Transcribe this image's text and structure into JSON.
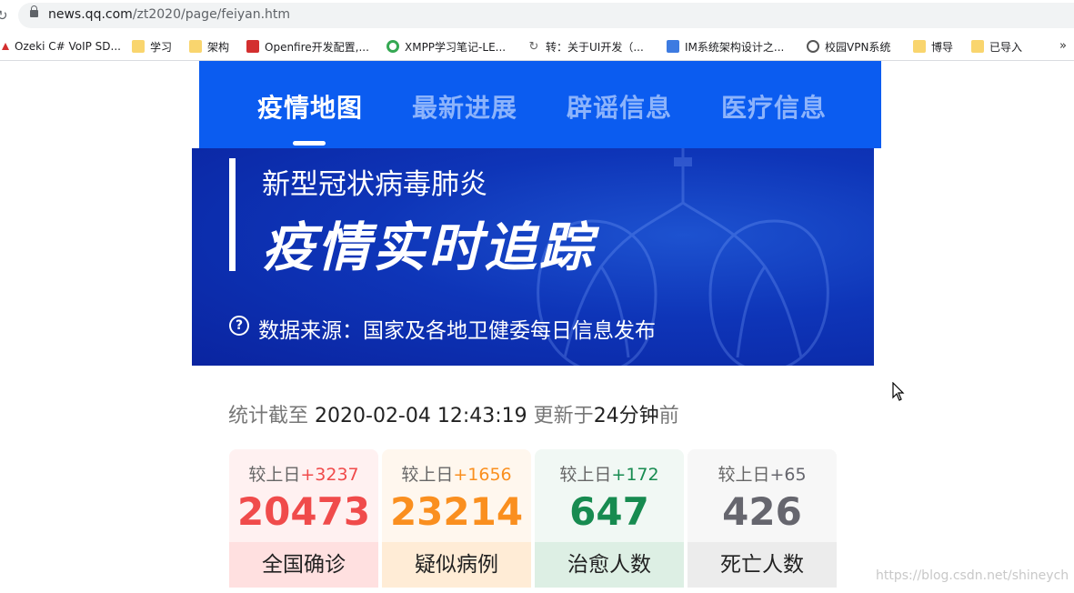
{
  "browser": {
    "url_host": "news.qq.com",
    "url_path": "/zt2020/page/feiyan.htm",
    "bookmarks": [
      {
        "label": "Ozeki C# VoIP SD...",
        "icon": "ozeki-icon"
      },
      {
        "label": "学习",
        "icon": "folder-icon"
      },
      {
        "label": "架构",
        "icon": "folder-icon"
      },
      {
        "label": "Openfire开发配置,...",
        "icon": "csdn-icon"
      },
      {
        "label": "XMPP学习笔记-LE...",
        "icon": "green-c-icon"
      },
      {
        "label": "转：关于UI开发（...",
        "icon": "spin-icon"
      },
      {
        "label": "IM系统架构设计之...",
        "icon": "blue-site-icon"
      },
      {
        "label": "校园VPN系统",
        "icon": "globe-icon"
      },
      {
        "label": "博导",
        "icon": "folder-icon"
      },
      {
        "label": "已导入",
        "icon": "folder-icon"
      }
    ],
    "more_label": "»"
  },
  "nav": {
    "tabs": [
      {
        "label": "疫情地图",
        "active": true
      },
      {
        "label": "最新进展",
        "active": false
      },
      {
        "label": "辟谣信息",
        "active": false
      },
      {
        "label": "医疗信息",
        "active": false
      }
    ]
  },
  "banner": {
    "subtitle": "新型冠状病毒肺炎",
    "title": "疫情实时追踪",
    "source": "数据来源：国家及各地卫健委每日信息发布"
  },
  "stats": {
    "prefix": "统计截至",
    "timestamp": "2020-02-04 12:43:19",
    "updated_prefix": "更新于",
    "updated_ago": "24分钟",
    "updated_suffix": "前",
    "cards": [
      {
        "delta_label": "较上日",
        "delta": "+3237",
        "value": "20473",
        "label": "全国确诊",
        "color": "#f04b4b",
        "bg": "#fff1f1",
        "foot_bg": "#ffe0e0"
      },
      {
        "delta_label": "较上日",
        "delta": "+1656",
        "value": "23214",
        "label": "疑似病例",
        "color": "#fa8f1f",
        "bg": "#fff7ee",
        "foot_bg": "#ffecd6"
      },
      {
        "delta_label": "较上日",
        "delta": "+172",
        "value": "647",
        "label": "治愈人数",
        "color": "#178b50",
        "bg": "#f1f8f4",
        "foot_bg": "#ddefe4"
      },
      {
        "delta_label": "较上日",
        "delta": "+65",
        "value": "426",
        "label": "死亡人数",
        "color": "#66666e",
        "bg": "#f7f7f7",
        "foot_bg": "#ececec"
      }
    ]
  },
  "watermark": "https://blog.csdn.net/shineych"
}
